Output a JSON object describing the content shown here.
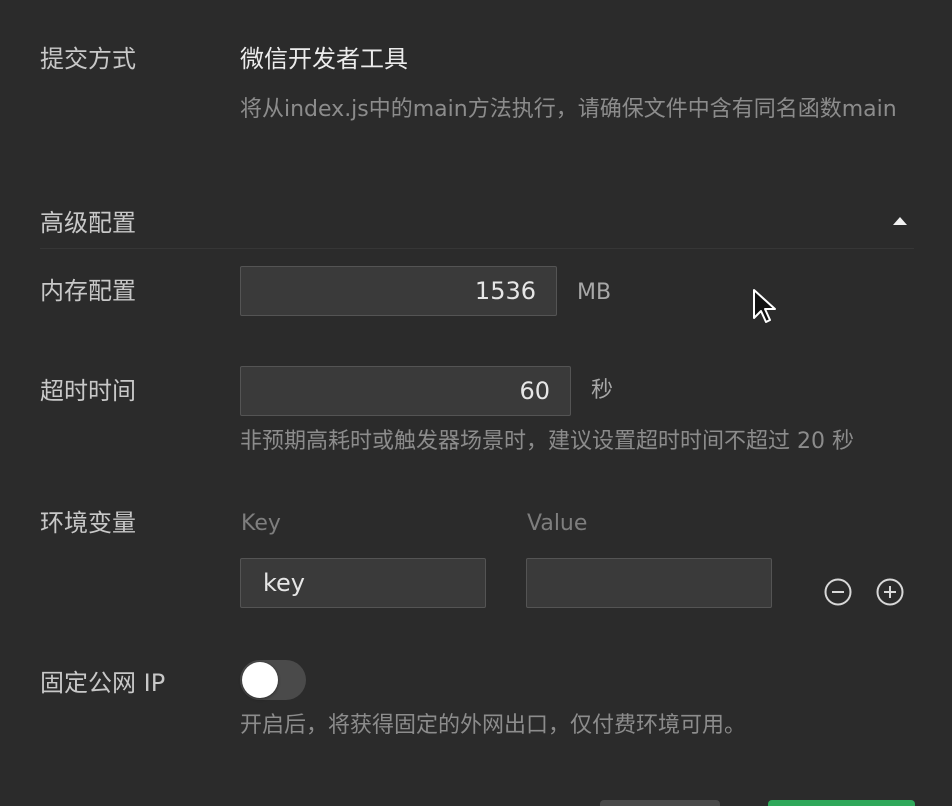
{
  "submit": {
    "label": "提交方式",
    "value": "微信开发者工具",
    "hint": "将从index.js中的main方法执行，请确保文件中含有同名函数main"
  },
  "advanced": {
    "label": "高级配置",
    "toggle_icon": "caret-up-icon"
  },
  "memory": {
    "label": "内存配置",
    "value": "1536",
    "unit": "MB"
  },
  "timeout": {
    "label": "超时时间",
    "value": "60",
    "unit": "秒",
    "hint": "非预期高耗时或触发器场景时，建议设置超时时间不超过 20 秒"
  },
  "env": {
    "label": "环境变量",
    "key_header": "Key",
    "value_header": "Value",
    "key_value": "key",
    "value_value": "",
    "remove_icon": "minus-circle-icon",
    "add_icon": "plus-circle-icon"
  },
  "fixed_ip": {
    "label": "固定公网 IP",
    "enabled": false,
    "hint": "开启后，将获得固定的外网出口，仅付费环境可用。"
  },
  "colors": {
    "background": "#2b2b2b",
    "input_bg": "#3a3a3a",
    "confirm_green": "#2fa85a"
  }
}
